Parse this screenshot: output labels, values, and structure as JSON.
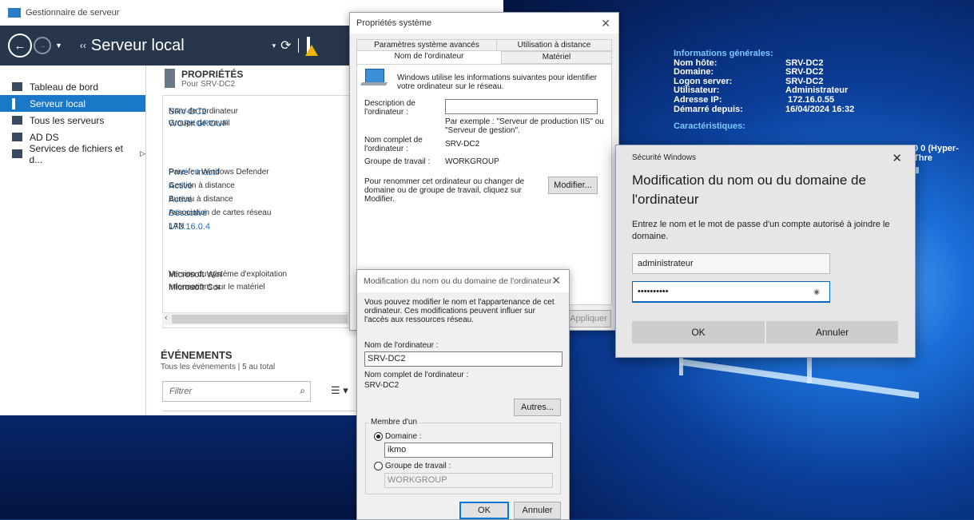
{
  "colors": {
    "accent": "#1978c8",
    "nav_bg": "#27364a",
    "link": "#1f6fb8",
    "warning": "#f0b400",
    "desktop_blue": "#0b3f9a"
  },
  "server_manager": {
    "window_title": "Gestionnaire de serveur",
    "breadcrumb_arrows": "‹‹",
    "breadcrumb": "Serveur local",
    "refresh_icon": "⟳",
    "sidebar": [
      {
        "label": "Tableau de bord",
        "icon": "dashboard-icon"
      },
      {
        "label": "Serveur local",
        "icon": "server-icon",
        "active": true
      },
      {
        "label": "Tous les serveurs",
        "icon": "servers-icon"
      },
      {
        "label": "AD DS",
        "icon": "ad-ds-icon"
      },
      {
        "label": "Services de fichiers et d...",
        "icon": "file-services-icon",
        "arrow": "▷"
      }
    ],
    "properties": {
      "title": "PROPRIÉTÉS",
      "subtitle": "Pour SRV-DC2",
      "rows": [
        {
          "label": "Nom de l'ordinateur",
          "value": "SRV-DC2"
        },
        {
          "label": "Groupe de travail",
          "value": "WORKGROUP"
        },
        {
          "label": "Pare-feu Windows Defender",
          "value": "Privé : Inactif"
        },
        {
          "label": "Gestion à distance",
          "value": "Activé"
        },
        {
          "label": "Bureau à distance",
          "value": "Activé"
        },
        {
          "label": "Association de cartes réseau",
          "value": "Désactivé"
        },
        {
          "label": "LAN",
          "value": "172.16.0.4"
        },
        {
          "label": "Version du système d'exploitation",
          "value": "Microsoft Windo"
        },
        {
          "label": "Informations sur le matériel",
          "value": "Microsoft Corpor"
        }
      ],
      "scroll_left": "‹"
    },
    "events": {
      "title": "ÉVÉNEMENTS",
      "subtitle": "Tous les événements | 5 au total",
      "filter_placeholder": "Filtrer",
      "search_icon": "⌕",
      "list_icon": "☰ ▾"
    }
  },
  "system_properties": {
    "title": "Propriétés système",
    "close": "✕",
    "tabs_row1": [
      "Paramètres système avancés",
      "Utilisation à distance"
    ],
    "tabs_row2": [
      "Nom de l'ordinateur",
      "Matériel"
    ],
    "intro": "Windows utilise les informations suivantes pour identifier votre ordinateur sur le réseau.",
    "description_label": "Description de l'ordinateur :",
    "description_value": "",
    "example": "Par exemple : \"Serveur de production IIS\" ou \"Serveur de gestion\".",
    "full_name_label": "Nom complet de l'ordinateur :",
    "full_name_value": "SRV-DC2",
    "workgroup_label": "Groupe de travail :",
    "workgroup_value": "WORKGROUP",
    "rename_text": "Pour renommer cet ordinateur ou changer de domaine ou de groupe de travail, cliquez sur Modifier.",
    "modify_button": "Modifier...",
    "apply_button": "Appliquer"
  },
  "rename_dialog": {
    "title": "Modification du nom ou du domaine de l'ordinateur",
    "close": "✕",
    "intro": "Vous pouvez modifier le nom et l'appartenance de cet ordinateur. Ces modifications peuvent influer sur l'accès aux ressources réseau.",
    "name_label": "Nom de l'ordinateur :",
    "name_value": "SRV-DC2",
    "full_name_label": "Nom complet de l'ordinateur :",
    "full_name_value": "SRV-DC2",
    "others_button": "Autres...",
    "member_of": "Membre d'un",
    "domain_label": "Domaine :",
    "domain_value": "ikmo",
    "workgroup_label": "Groupe de travail :",
    "workgroup_value": "WORKGROUP",
    "ok_button": "OK",
    "cancel_button": "Annuler"
  },
  "security_dialog": {
    "title": "Sécurité Windows",
    "close": "✕",
    "heading": "Modification du nom ou du domaine de l'ordinateur",
    "description": "Entrez le nom et le mot de passe d'un compte autorisé à joindre le domaine.",
    "username_value": "administrateur",
    "password_value": "••••••••••",
    "reveal_icon": "◉",
    "ok_button": "OK",
    "cancel_button": "Annuler"
  },
  "bginfo": {
    "header1": "Informations générales:",
    "rows": [
      {
        "k": "Nom hôte:",
        "v": "SRV-DC2"
      },
      {
        "k": "Domaine:",
        "v": "SRV-DC2"
      },
      {
        "k": "Logon server:",
        "v": "SRV-DC2"
      },
      {
        "k": "Utilisateur:",
        "v": "Administrateur"
      },
      {
        "k": "Adresse IP:",
        "v": " 172.16.0.55"
      },
      {
        "k": "Démarré depuis:",
        "v": "16/04/2024 16:32"
      }
    ],
    "header2": "Caractéristiques:",
    "cpu_fragment": "0 0 (Hyper-Thre"
  }
}
